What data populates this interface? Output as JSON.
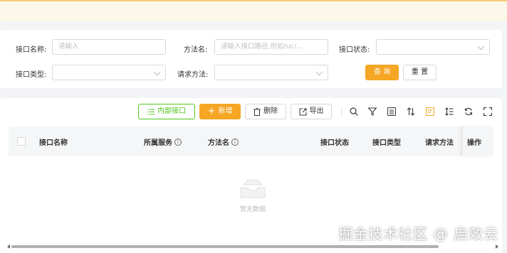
{
  "search": {
    "interface_name_label": "接口名称:",
    "interface_name_placeholder": "请输入",
    "method_name_label": "方法名:",
    "method_name_placeholder": "请输入接口路径,例如/uc/...",
    "interface_status_label": "接口状态:",
    "interface_type_label": "接口类型:",
    "request_method_label": "请求方法:",
    "query_button": "查 询",
    "reset_button": "重 置"
  },
  "toolbar": {
    "internal_interface": "内部接口",
    "add": "新增",
    "delete": "删除",
    "export": "导出",
    "icons": [
      "search-icon",
      "filter-icon",
      "list-icon",
      "sort-icon",
      "column-settings-icon",
      "density-icon",
      "refresh-icon",
      "fullscreen-icon"
    ]
  },
  "table": {
    "columns": [
      "接口名称",
      "所属服务",
      "方法名",
      "接口状态",
      "接口类型",
      "请求方法",
      "操作"
    ],
    "empty_text": "暂无数据"
  },
  "watermark": "掘金技术社区 @ 启效云",
  "colors": {
    "primary": "#f5a623",
    "green": "#52c41a"
  }
}
